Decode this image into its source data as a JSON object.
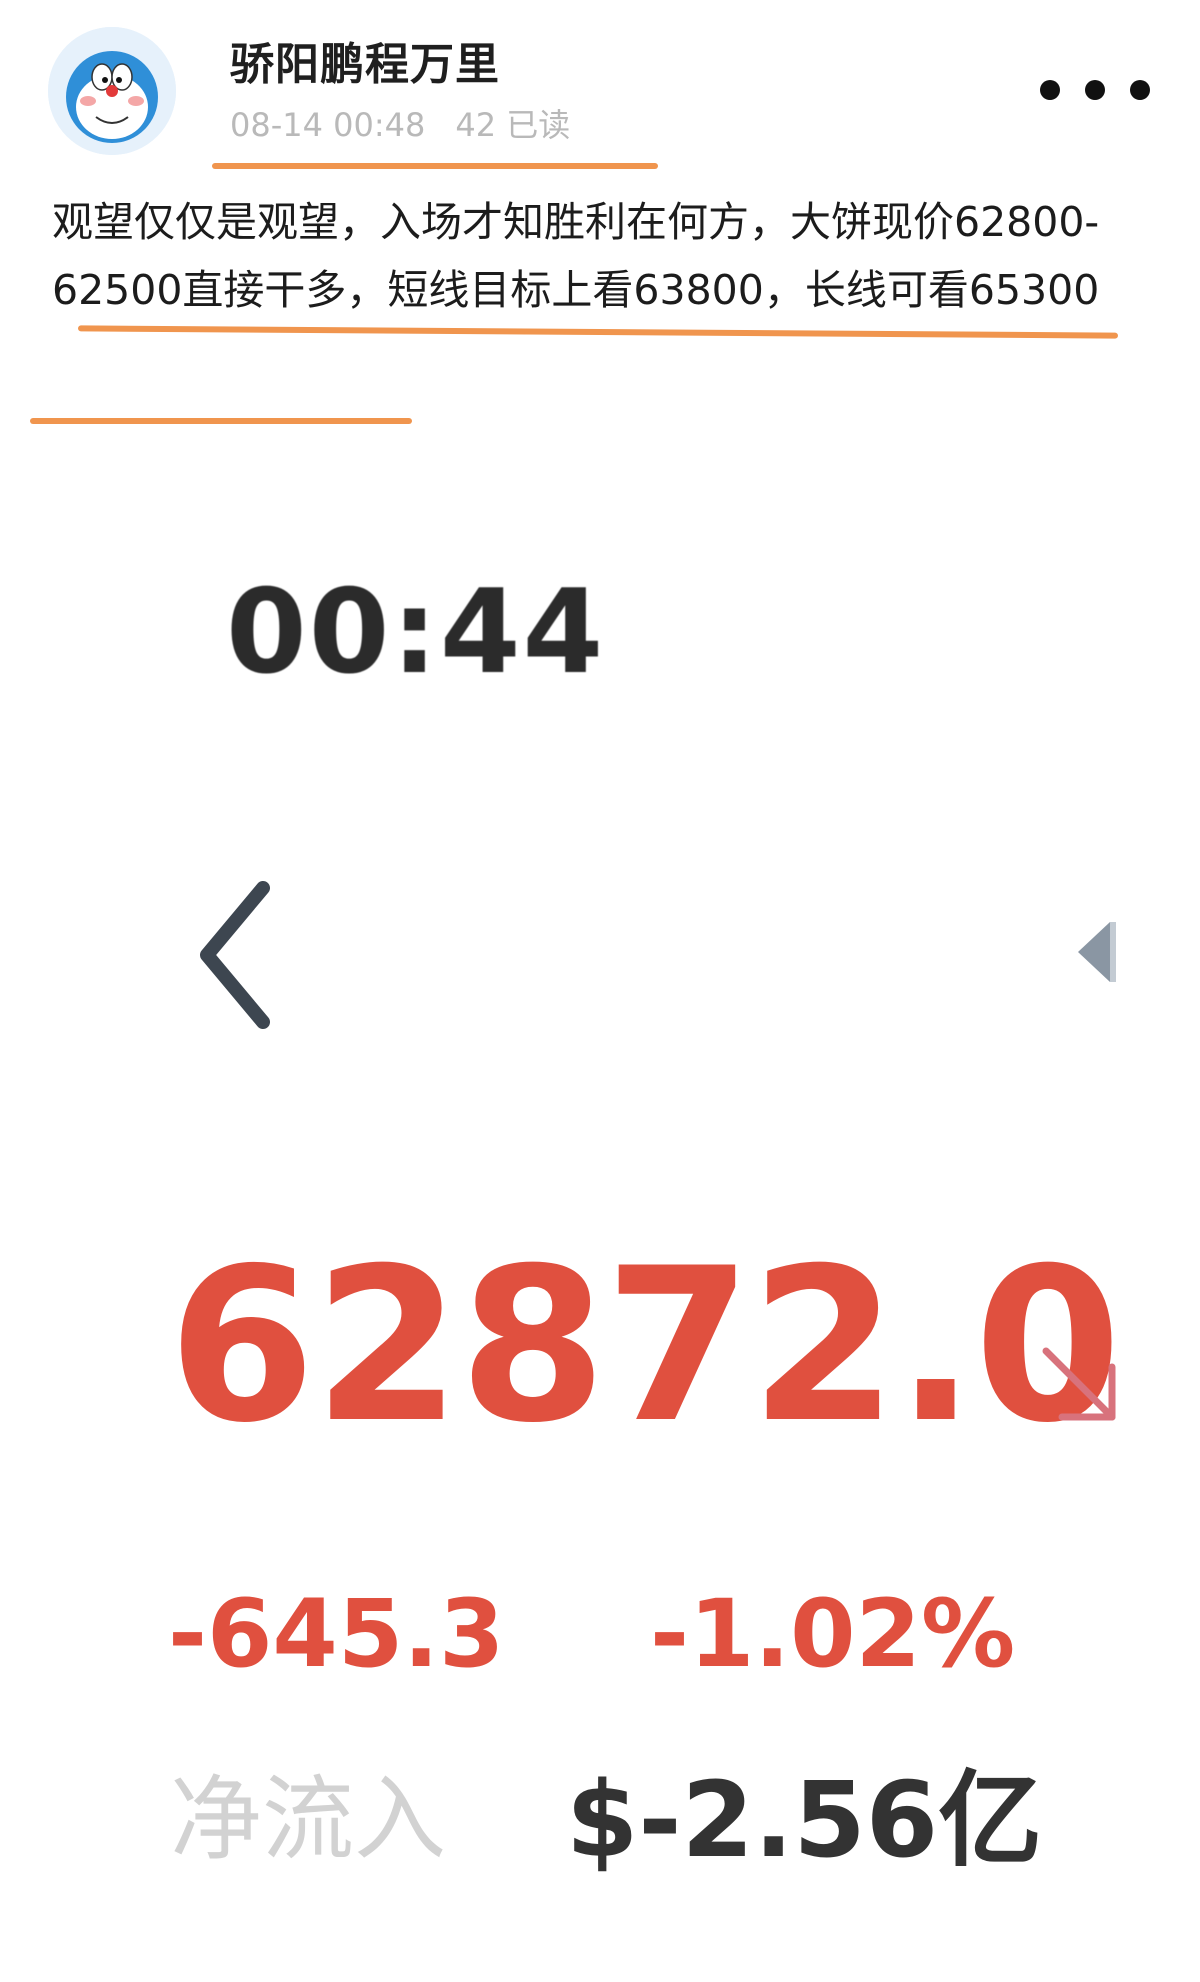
{
  "post": {
    "author": "骄阳鹏程万里",
    "date_time": "08-14 00:48",
    "reads": "42 已读",
    "text": "观望仅仅是观望，入场才知胜利在何方，大饼现价62800-62500直接干多，短线目标上看63800，长线可看65300"
  },
  "icons": {
    "avatar": "doraemon-avatar",
    "more": "more-icon",
    "back": "chevron-left-icon",
    "right": "triangle-left-icon",
    "trend": "arrow-down-right-icon"
  },
  "ticker": {
    "timer": "00:44",
    "price": "62872.0",
    "change_abs": "-645.3",
    "change_pct": "-1.02%",
    "netflow_label": "净流入",
    "netflow_value": "$-2.56亿"
  },
  "colors": {
    "accent_orange": "#f0954e",
    "price_red": "#e0503f",
    "meta_gray": "#b9b9b9"
  }
}
